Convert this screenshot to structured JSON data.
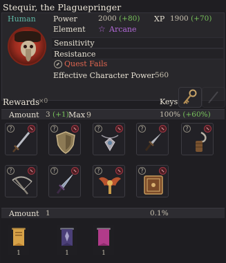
{
  "title": "Stequir, the Plaguepringer",
  "character": {
    "race": "Human",
    "power_label": "Power",
    "power_value": "2000",
    "power_bonus": "(+80)",
    "xp_label": "XP",
    "xp_value": "1900",
    "xp_bonus": "(+70)",
    "element_label": "Element",
    "element_icon": "☆",
    "element_value": "Arcane",
    "sensitivity_label": "Sensitivity",
    "resistance_label": "Resistance",
    "quest_status": "Quest Fails",
    "ecp_label": "Effective Character Power",
    "ecp_value": "560"
  },
  "rewards": {
    "label": "Rewards",
    "count": "×0",
    "keys_label": "Keys"
  },
  "group1": {
    "amount_label": "Amount",
    "amount_value": "3",
    "amount_bonus": "(+1)",
    "max_label": "Max",
    "max_value": "9",
    "percent": "100%",
    "percent_bonus": "(+60%)",
    "items": [
      {
        "name": "sword-icon"
      },
      {
        "name": "shield-icon"
      },
      {
        "name": "amulet-icon"
      },
      {
        "name": "dagger-icon"
      },
      {
        "name": "hook-icon"
      },
      {
        "name": "crossbow-icon"
      },
      {
        "name": "blade-icon"
      },
      {
        "name": "wings-emblem-icon"
      },
      {
        "name": "tome-icon"
      }
    ]
  },
  "group2": {
    "amount_label": "Amount",
    "amount_value": "1",
    "percent": "0.1%",
    "items": [
      {
        "name": "scroll-gold-icon",
        "count": "1"
      },
      {
        "name": "scroll-purple-icon",
        "count": "1"
      },
      {
        "name": "scroll-pink-icon",
        "count": "1"
      }
    ]
  },
  "colors": {
    "race": "#5fb6a4",
    "bonus": "#78c25b",
    "arcane": "#b26ad8",
    "quest_fail": "#e06650"
  }
}
